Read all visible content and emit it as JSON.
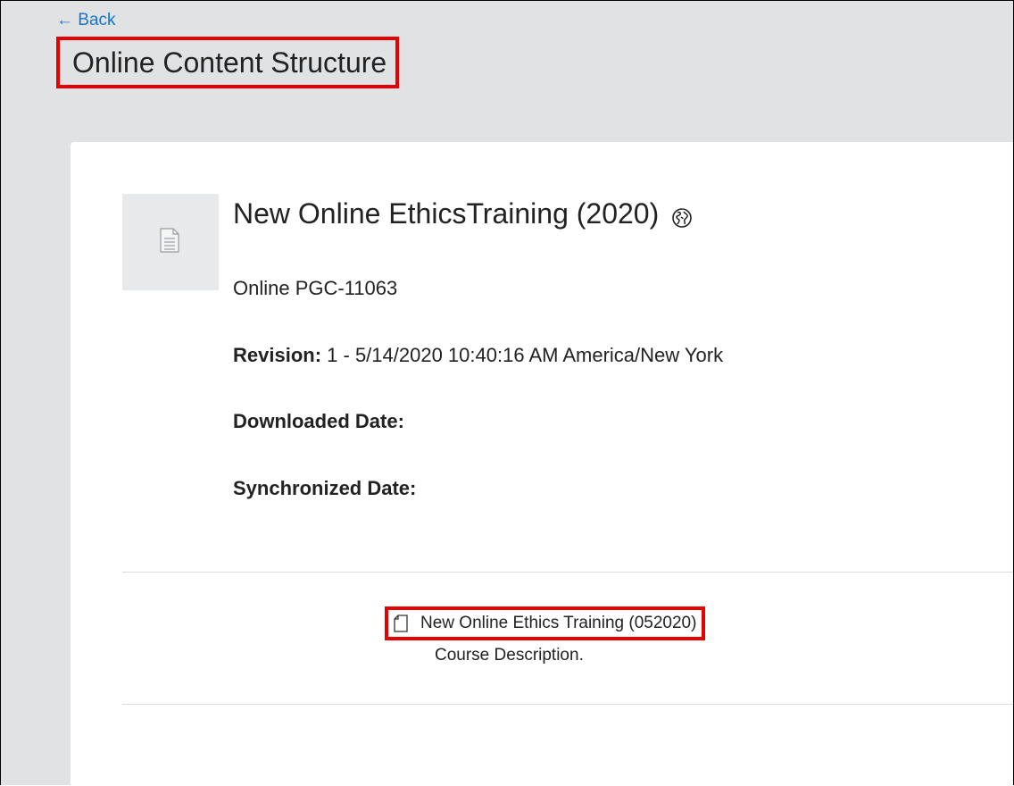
{
  "nav": {
    "back_label": "← Back"
  },
  "page": {
    "title": "Online Content Structure"
  },
  "course": {
    "title": "New Online EthicsTraining (2020)",
    "code": "Online PGC-11063",
    "revision_label": "Revision:",
    "revision_value": "1 - 5/14/2020 10:40:16 AM America/New York",
    "downloaded_label": "Downloaded Date:",
    "synchronized_label": "Synchronized Date:",
    "thumbnail_icon": "document-icon",
    "status_icon": "globe-icon"
  },
  "content_item": {
    "title": "New Online Ethics Training (052020)",
    "description": "Course Description.",
    "icon": "file-icon"
  },
  "colors": {
    "link": "#1a73c8",
    "highlight": "#e60000",
    "background": "#e0e2e4"
  }
}
